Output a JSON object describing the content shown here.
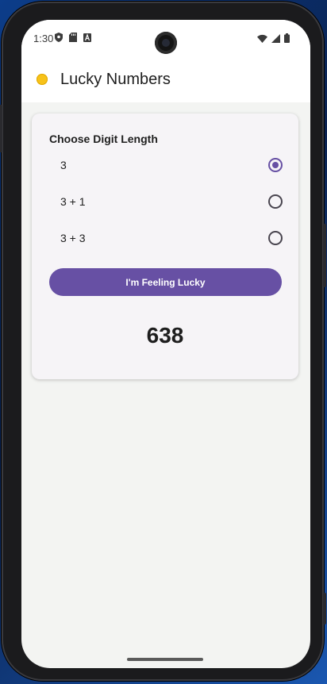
{
  "status_bar": {
    "time": "1:30",
    "left_icons": [
      "shield-icon",
      "sd-card-icon",
      "font-download-icon"
    ],
    "right_icons": [
      "wifi-icon",
      "signal-icon",
      "battery-icon"
    ]
  },
  "app_bar": {
    "title": "Lucky Numbers",
    "logo_icon": "coin-icon",
    "logo_color": "#f7c21a"
  },
  "card": {
    "title": "Choose Digit Length",
    "options": [
      {
        "label": "3",
        "selected": true
      },
      {
        "label": "3 + 1",
        "selected": false
      },
      {
        "label": "3 + 3",
        "selected": false
      }
    ],
    "button_label": "I'm Feeling Lucky",
    "result": "638"
  },
  "colors": {
    "accent": "#6750a4",
    "background": "#f3f4f2",
    "card": "#f6f4f7"
  }
}
